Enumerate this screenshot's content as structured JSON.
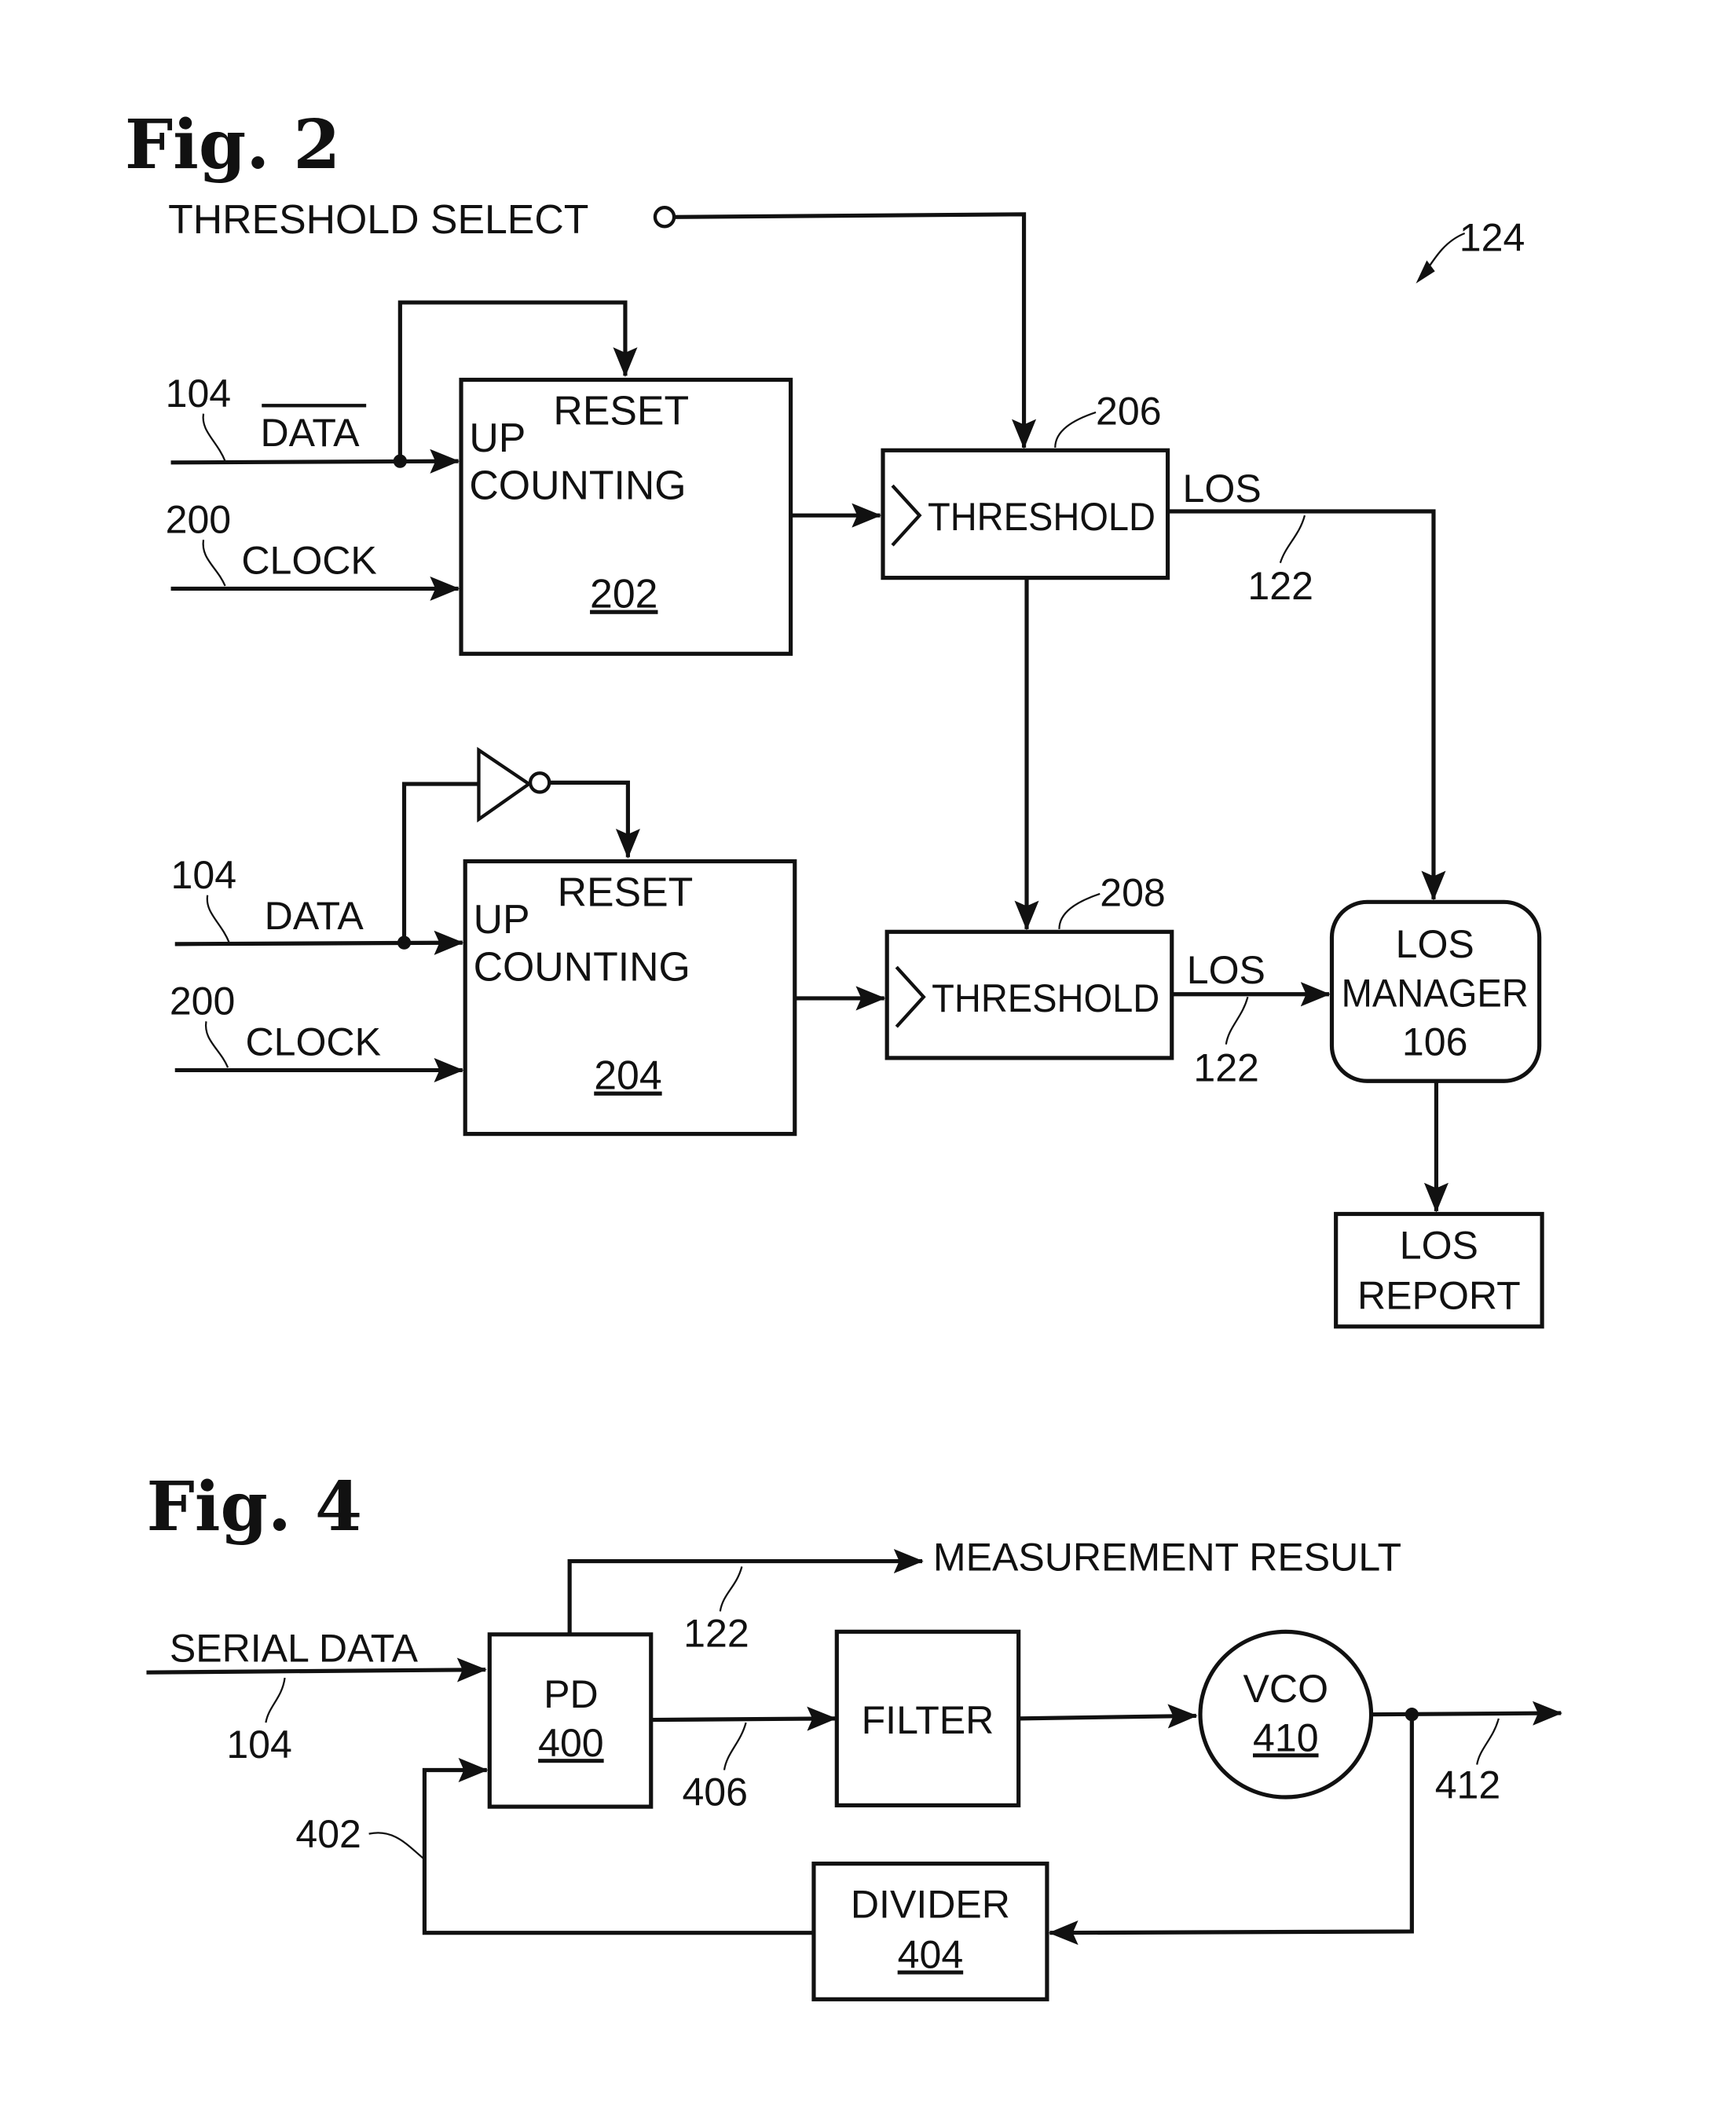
{
  "fig2": {
    "title": "Fig. 2",
    "ref_number": "124",
    "threshold_select": "THRESHOLD SELECT",
    "counter_top": {
      "input_ref": "104",
      "input_label": "DATA",
      "input_inverted": true,
      "clock_ref": "200",
      "clock_label": "CLOCK",
      "reset": "RESET",
      "up": "UP",
      "name": "COUNTING",
      "ref": "202"
    },
    "counter_bottom": {
      "input_ref": "104",
      "input_label": "DATA",
      "input_inverted": false,
      "clock_ref": "200",
      "clock_label": "CLOCK",
      "reset": "RESET",
      "up": "UP",
      "name": "COUNTING",
      "ref": "204"
    },
    "threshold_top": {
      "label": "THRESHOLD",
      "ref": "206",
      "out_label": "LOS",
      "out_ref": "122"
    },
    "threshold_bottom": {
      "label": "THRESHOLD",
      "ref": "208",
      "out_label": "LOS",
      "out_ref": "122"
    },
    "los_manager": {
      "line1": "LOS",
      "line2": "MANAGER",
      "ref": "106"
    },
    "los_report": {
      "line1": "LOS",
      "line2": "REPORT"
    }
  },
  "fig4": {
    "title": "Fig. 4",
    "serial_data": "SERIAL DATA",
    "serial_ref": "104",
    "measurement": "MEASUREMENT RESULT",
    "measurement_ref": "122",
    "pd": {
      "label": "PD",
      "ref": "400"
    },
    "pd_out_ref": "406",
    "filter": {
      "label": "FILTER"
    },
    "vco": {
      "label": "VCO",
      "ref": "410"
    },
    "vco_out_ref": "412",
    "divider": {
      "label": "DIVIDER",
      "ref": "404"
    },
    "feedback_ref": "402"
  }
}
